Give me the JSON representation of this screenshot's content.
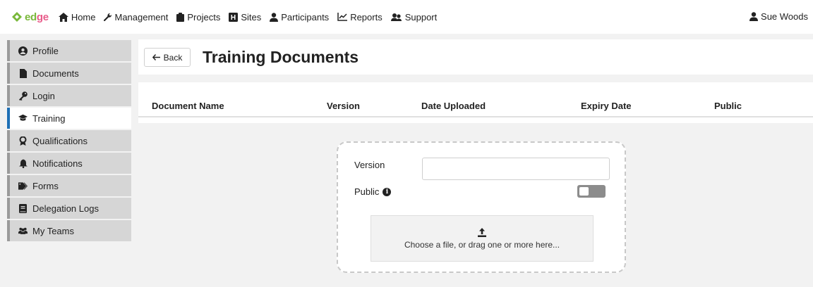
{
  "app": {
    "logo_text_1": "ed",
    "logo_text_2": "ge",
    "brand_green": "#79b83a",
    "brand_pink": "#e85b8a"
  },
  "nav": {
    "items": [
      {
        "label": "Home",
        "icon": "home-icon"
      },
      {
        "label": "Management",
        "icon": "wrench-icon"
      },
      {
        "label": "Projects",
        "icon": "clipboard-icon"
      },
      {
        "label": "Sites",
        "icon": "hospital-icon"
      },
      {
        "label": "Participants",
        "icon": "user-icon"
      },
      {
        "label": "Reports",
        "icon": "line-chart-icon"
      },
      {
        "label": "Support",
        "icon": "people-support-icon"
      }
    ],
    "user_name": "Sue Woods"
  },
  "sidebar": {
    "active_color": "#1e6fb5",
    "items": [
      {
        "label": "Profile",
        "icon": "user-circle-icon"
      },
      {
        "label": "Documents",
        "icon": "file-icon"
      },
      {
        "label": "Login",
        "icon": "key-icon"
      },
      {
        "label": "Training",
        "icon": "graduation-cap-icon",
        "active": true
      },
      {
        "label": "Qualifications",
        "icon": "certificate-icon"
      },
      {
        "label": "Notifications",
        "icon": "bell-icon"
      },
      {
        "label": "Forms",
        "icon": "tag-icon"
      },
      {
        "label": "Delegation Logs",
        "icon": "book-icon"
      },
      {
        "label": "My Teams",
        "icon": "users-icon"
      }
    ]
  },
  "main": {
    "back_label": "Back",
    "title": "Training Documents",
    "table": {
      "columns": [
        "Document Name",
        "Version",
        "Date Uploaded",
        "Expiry Date",
        "Public"
      ]
    },
    "upload": {
      "version_label": "Version",
      "version_value": "",
      "public_label": "Public",
      "public_on": false,
      "dropzone_text": "Choose a file, or drag one or more here..."
    }
  }
}
